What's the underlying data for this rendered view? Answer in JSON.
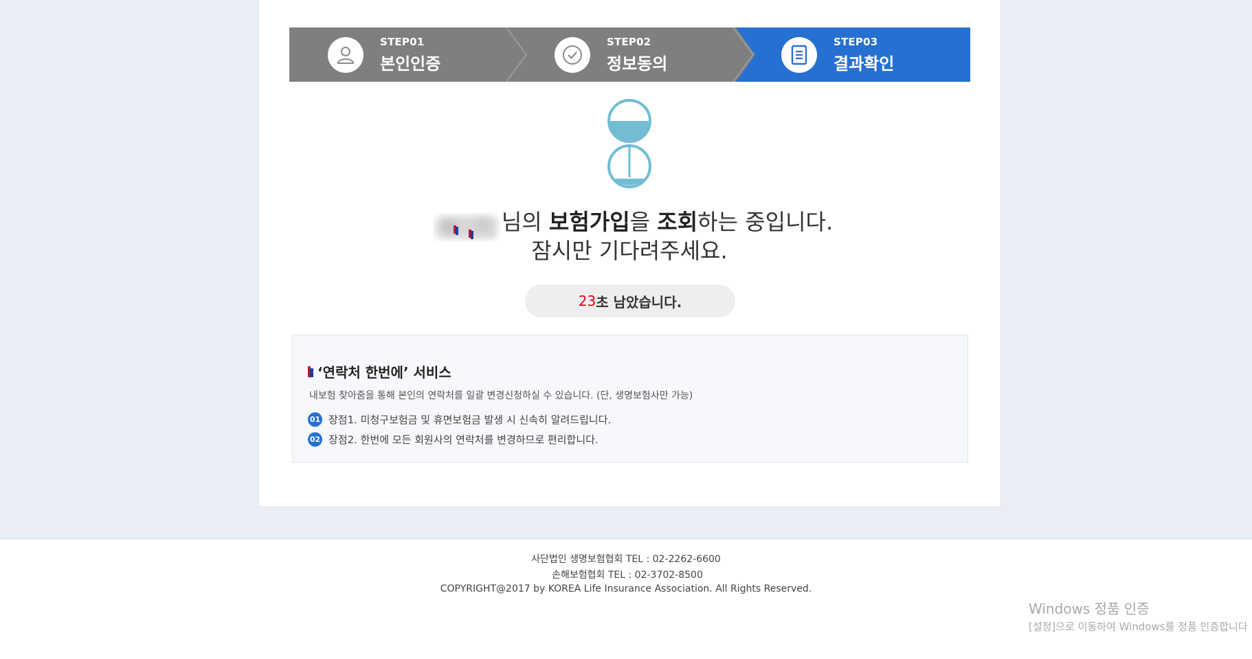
{
  "steps": [
    {
      "num": "STEP01",
      "title": "본인인증",
      "icon": "user-icon"
    },
    {
      "num": "STEP02",
      "title": "정보동의",
      "icon": "check-circle-icon"
    },
    {
      "num": "STEP03",
      "title": "결과확인",
      "icon": "document-icon"
    }
  ],
  "colors": {
    "step_inactive": "#7f7f7f",
    "step_active": "#2670d1",
    "accent_red": "#e60012",
    "hourglass": "#72bcd4"
  },
  "message": {
    "name_suffix": "님의 ",
    "bold1": "보험가입",
    "mid": "을 ",
    "bold2": "조회",
    "tail": "하는 중입니다.",
    "line2": "잠시만 기다려주세요."
  },
  "countdown": {
    "seconds": "23",
    "suffix": "초 남았습니다."
  },
  "service": {
    "title": "‘연락처 한번에’ 서비스",
    "desc": "내보험 찾아줌을 통해 본인의 연락처를 일괄 변경신청하실 수 있습니다. (단, 생명보험사만 가능)",
    "items": [
      {
        "badge": "01",
        "text": "장점1. 미청구보험금 및 휴면보험금 발생 시 신속히 알려드립니다."
      },
      {
        "badge": "02",
        "text": "장점2. 한번에 모든 회원사의 연락처를 변경하므로 편리합니다."
      }
    ]
  },
  "footer": {
    "line1": "사단법인 생명보험협회 TEL : 02-2262-6600",
    "line2": "손해보험협회 TEL : 02-3702-8500",
    "line3": "COPYRIGHT@2017 by KOREA Life Insurance Association. All Rights Reserved."
  },
  "watermark": {
    "line1": "Windows 정품 인증",
    "line2": "[설정]으로 이동하여 Windows를 정품 인증합니다"
  }
}
